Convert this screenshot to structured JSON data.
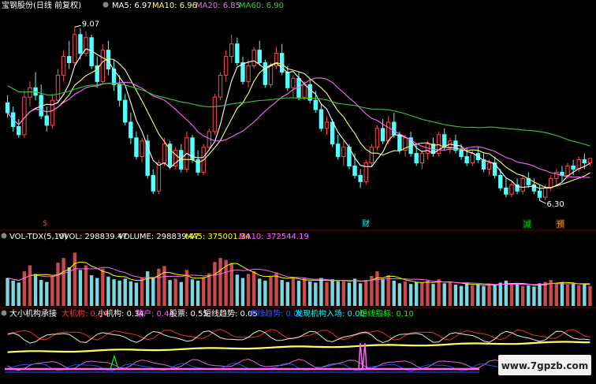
{
  "colors": {
    "background": "#000000",
    "up_candle": "#ff4a4a",
    "down_candle": "#54ffff",
    "ma5": "#ffffff",
    "ma10": "#ffff66",
    "ma20": "#ff66ff",
    "ma60": "#33cc33",
    "panel_divider": "#7a0000",
    "info_white": "#ffffff",
    "info_yellow": "#ffff00",
    "info_magenta": "#ff66ff",
    "info_green": "#00ff00",
    "info_red": "#ff3333",
    "info_blue": "#3355ff",
    "info_cyan": "#00ffff",
    "marker_red": "#ff3333",
    "marker_cyan": "#00ffff",
    "marker_green": "#00cc00",
    "marker_orange": "#ff9900"
  },
  "watermark": "www.7gpzb.com",
  "price_panel": {
    "title": "宝钢股份(日线 前复权)",
    "ma_items": [
      {
        "label": "MA5: 6.97",
        "color": "#ffffff"
      },
      {
        "label": "MA10: 6.96",
        "color": "#ffff66"
      },
      {
        "label": "MA20: 6.85",
        "color": "#ff66ff"
      },
      {
        "label": "MA60: 6.90",
        "color": "#33cc33"
      }
    ],
    "high_label": "9.07",
    "low_label": "6.30",
    "event_markers": [
      {
        "text": "$",
        "color": "#ff3333"
      },
      {
        "text": "财",
        "color": "#00ffff"
      },
      {
        "text": "减",
        "color": "#00cc00"
      },
      {
        "text": "预",
        "color": "#ff9900"
      }
    ]
  },
  "volume_panel": {
    "indicator": "VOL-TDX(5,10)",
    "items": [
      {
        "label": "VVOL: 298839.47",
        "color": "#ffffff"
      },
      {
        "label": "VOLUME: 298839.47",
        "color": "#ffffff"
      },
      {
        "label": "MA5: 375001.34",
        "color": "#ffff00"
      },
      {
        "label": "MA10: 372544.19",
        "color": "#ff66ff"
      }
    ]
  },
  "institution_panel": {
    "indicator": "大小机构承接",
    "items": [
      {
        "label": "大机构: 0.34",
        "color": "#ff3333"
      },
      {
        "label": "小机构: 0.34",
        "color": "#ffffff"
      },
      {
        "label": "散户: 0.44",
        "color": "#ff66ff"
      },
      {
        "label": "股票: 0.55",
        "color": "#ffffff"
      },
      {
        "label": "短线趋势: 0.05",
        "color": "#ffffff"
      },
      {
        "label": "中线趋势: 0.06",
        "color": "#3355ff"
      },
      {
        "label": "发现机构入场: 0.00",
        "color": "#00ffff"
      },
      {
        "label": "短线指标: 0.10",
        "color": "#00ff00"
      }
    ]
  },
  "chart_data": [
    {
      "type": "candlestick",
      "title": "宝钢股份(日线 前复权)",
      "ylim": [
        6.0,
        9.3
      ],
      "ohlc": [
        [
          7.86,
          7.98,
          7.62,
          7.7
        ],
        [
          7.7,
          7.8,
          7.4,
          7.48
        ],
        [
          7.48,
          7.6,
          7.3,
          7.35
        ],
        [
          7.35,
          8.05,
          7.3,
          7.95
        ],
        [
          7.95,
          8.2,
          7.8,
          8.1
        ],
        [
          8.1,
          8.35,
          7.9,
          7.98
        ],
        [
          7.98,
          8.15,
          7.6,
          7.65
        ],
        [
          7.65,
          7.8,
          7.4,
          7.5
        ],
        [
          7.5,
          8.0,
          7.45,
          7.9
        ],
        [
          7.9,
          8.4,
          7.85,
          8.3
        ],
        [
          8.3,
          8.7,
          8.2,
          8.6
        ],
        [
          8.6,
          8.85,
          8.4,
          8.5
        ],
        [
          8.5,
          9.07,
          8.45,
          8.95
        ],
        [
          8.95,
          9.05,
          8.55,
          8.65
        ],
        [
          8.65,
          9.0,
          8.6,
          8.9
        ],
        [
          8.9,
          8.95,
          8.4,
          8.45
        ],
        [
          8.45,
          8.6,
          8.1,
          8.2
        ],
        [
          8.2,
          8.8,
          8.15,
          8.7
        ],
        [
          8.7,
          8.85,
          8.3,
          8.4
        ],
        [
          8.4,
          8.55,
          8.05,
          8.15
        ],
        [
          8.15,
          8.3,
          7.8,
          7.9
        ],
        [
          7.9,
          8.0,
          7.5,
          7.55
        ],
        [
          7.55,
          7.7,
          7.2,
          7.3
        ],
        [
          7.3,
          7.4,
          6.95,
          7.0
        ],
        [
          7.0,
          7.3,
          6.9,
          7.25
        ],
        [
          7.25,
          7.35,
          6.65,
          6.7
        ],
        [
          6.7,
          6.8,
          6.4,
          6.45
        ],
        [
          6.45,
          6.95,
          6.4,
          6.9
        ],
        [
          6.9,
          7.3,
          6.85,
          7.2
        ],
        [
          7.2,
          7.25,
          6.8,
          6.85
        ],
        [
          6.85,
          7.15,
          6.8,
          7.1
        ],
        [
          7.1,
          7.2,
          6.75,
          6.8
        ],
        [
          6.8,
          7.4,
          6.75,
          7.3
        ],
        [
          7.3,
          7.35,
          6.9,
          6.95
        ],
        [
          6.95,
          7.1,
          6.7,
          6.75
        ],
        [
          6.75,
          7.2,
          6.7,
          7.15
        ],
        [
          7.15,
          7.45,
          7.1,
          7.4
        ],
        [
          7.4,
          8.0,
          7.35,
          7.95
        ],
        [
          7.95,
          8.35,
          7.9,
          8.3
        ],
        [
          8.3,
          8.7,
          8.2,
          8.6
        ],
        [
          8.6,
          8.95,
          8.5,
          8.8
        ],
        [
          8.8,
          8.9,
          8.45,
          8.5
        ],
        [
          8.5,
          8.6,
          8.15,
          8.2
        ],
        [
          8.2,
          8.55,
          8.1,
          8.45
        ],
        [
          8.45,
          8.75,
          8.4,
          8.7
        ],
        [
          8.7,
          8.85,
          8.45,
          8.5
        ],
        [
          8.5,
          8.55,
          8.1,
          8.15
        ],
        [
          8.15,
          8.5,
          8.1,
          8.45
        ],
        [
          8.45,
          8.75,
          8.4,
          8.65
        ],
        [
          8.65,
          8.8,
          8.3,
          8.35
        ],
        [
          8.35,
          8.45,
          8.05,
          8.1
        ],
        [
          8.1,
          8.3,
          7.95,
          8.25
        ],
        [
          8.25,
          8.35,
          7.9,
          7.95
        ],
        [
          7.95,
          8.2,
          7.9,
          8.15
        ],
        [
          8.15,
          8.25,
          7.85,
          7.9
        ],
        [
          7.9,
          8.05,
          7.7,
          7.75
        ],
        [
          7.75,
          7.85,
          7.4,
          7.45
        ],
        [
          7.45,
          7.65,
          7.35,
          7.55
        ],
        [
          7.55,
          7.6,
          7.15,
          7.2
        ],
        [
          7.2,
          7.35,
          6.95,
          7.0
        ],
        [
          7.0,
          7.25,
          6.85,
          7.15
        ],
        [
          7.15,
          7.2,
          6.8,
          6.85
        ],
        [
          6.85,
          7.05,
          6.65,
          6.7
        ],
        [
          6.7,
          6.8,
          6.5,
          6.6
        ],
        [
          6.6,
          6.95,
          6.55,
          6.9
        ],
        [
          6.9,
          7.2,
          6.85,
          7.15
        ],
        [
          7.15,
          7.5,
          7.1,
          7.45
        ],
        [
          7.45,
          7.6,
          7.2,
          7.25
        ],
        [
          7.25,
          7.65,
          7.2,
          7.55
        ],
        [
          7.55,
          7.7,
          7.3,
          7.35
        ],
        [
          7.35,
          7.4,
          7.05,
          7.1
        ],
        [
          7.1,
          7.35,
          7.0,
          7.3
        ],
        [
          7.3,
          7.4,
          7.0,
          7.05
        ],
        [
          7.05,
          7.2,
          6.85,
          6.9
        ],
        [
          6.9,
          7.1,
          6.8,
          7.05
        ],
        [
          7.05,
          7.25,
          6.95,
          7.2
        ],
        [
          7.2,
          7.3,
          7.0,
          7.05
        ],
        [
          7.05,
          7.4,
          7.0,
          7.35
        ],
        [
          7.35,
          7.45,
          7.1,
          7.15
        ],
        [
          7.15,
          7.3,
          7.05,
          7.25
        ],
        [
          7.25,
          7.35,
          7.05,
          7.1
        ],
        [
          7.1,
          7.2,
          6.95,
          7.0
        ],
        [
          7.0,
          7.15,
          6.85,
          6.9
        ],
        [
          6.9,
          7.1,
          6.85,
          7.05
        ],
        [
          7.05,
          7.15,
          6.9,
          6.95
        ],
        [
          6.95,
          7.05,
          6.75,
          6.8
        ],
        [
          6.8,
          6.95,
          6.7,
          6.9
        ],
        [
          6.9,
          7.0,
          6.65,
          6.7
        ],
        [
          6.7,
          6.8,
          6.45,
          6.5
        ],
        [
          6.5,
          6.65,
          6.35,
          6.4
        ],
        [
          6.4,
          6.6,
          6.35,
          6.55
        ],
        [
          6.55,
          6.65,
          6.4,
          6.45
        ],
        [
          6.45,
          6.7,
          6.4,
          6.65
        ],
        [
          6.65,
          6.75,
          6.5,
          6.55
        ],
        [
          6.55,
          6.65,
          6.4,
          6.45
        ],
        [
          6.45,
          6.55,
          6.3,
          6.35
        ],
        [
          6.35,
          6.55,
          6.3,
          6.5
        ],
        [
          6.5,
          6.7,
          6.45,
          6.65
        ],
        [
          6.65,
          6.8,
          6.55,
          6.75
        ],
        [
          6.75,
          6.85,
          6.6,
          6.7
        ],
        [
          6.7,
          6.9,
          6.65,
          6.85
        ],
        [
          6.85,
          6.95,
          6.7,
          6.8
        ],
        [
          6.8,
          7.0,
          6.75,
          6.95
        ],
        [
          6.95,
          7.05,
          6.8,
          6.9
        ],
        [
          6.9,
          6.98,
          6.85,
          6.97
        ]
      ],
      "ma": [
        {
          "name": "MA5",
          "period": 5,
          "color": "#ffffff"
        },
        {
          "name": "MA10",
          "period": 10,
          "color": "#ffff66"
        },
        {
          "name": "MA20",
          "period": 20,
          "color": "#ff66ff"
        },
        {
          "name": "MA60",
          "period": 60,
          "color": "#33cc33"
        }
      ],
      "annotations": [
        {
          "text": "9.07",
          "index": 12,
          "value": 9.07
        },
        {
          "text": "6.30",
          "index": 95,
          "value": 6.3
        }
      ]
    },
    {
      "type": "bar",
      "title": "VOL-TDX(5,10)",
      "series_names": [
        "VOLUME",
        "MA5",
        "MA10"
      ],
      "up_flags_source": "candles",
      "ylim": [
        0,
        900000
      ],
      "values": [
        420000,
        380000,
        350000,
        520000,
        610000,
        480000,
        390000,
        360000,
        450000,
        650000,
        720000,
        580000,
        800000,
        540000,
        610000,
        460000,
        420000,
        560000,
        440000,
        400000,
        380000,
        410000,
        370000,
        350000,
        420000,
        520000,
        430000,
        560000,
        600000,
        390000,
        410000,
        360000,
        540000,
        400000,
        380000,
        430000,
        490000,
        660000,
        720000,
        690000,
        640000,
        470000,
        420000,
        480000,
        520000,
        410000,
        380000,
        440000,
        500000,
        390000,
        360000,
        410000,
        380000,
        420000,
        370000,
        350000,
        420000,
        360000,
        400000,
        370000,
        380000,
        350000,
        410000,
        340000,
        390000,
        450000,
        520000,
        410000,
        460000,
        380000,
        340000,
        370000,
        330000,
        360000,
        350000,
        380000,
        330000,
        400000,
        340000,
        360000,
        320000,
        300000,
        340000,
        310000,
        330000,
        300000,
        310000,
        320000,
        350000,
        380000,
        320000,
        330000,
        300000,
        310000,
        290000,
        340000,
        360000,
        390000,
        330000,
        350000,
        320000,
        340000,
        310000,
        330000,
        298839
      ]
    },
    {
      "type": "line",
      "title": "大小机构承接",
      "ylim": [
        0,
        1
      ],
      "series": [
        {
          "name": "大机构",
          "color": "#ff3333"
        },
        {
          "name": "小机构",
          "color": "#ffffff"
        },
        {
          "name": "散户",
          "color": "#ff66ff"
        },
        {
          "name": "股票",
          "color": "#ffff66"
        },
        {
          "name": "中线趋势",
          "color": "#3355ff"
        },
        {
          "name": "发现机构入场",
          "color": "#ff66ff"
        }
      ]
    }
  ]
}
